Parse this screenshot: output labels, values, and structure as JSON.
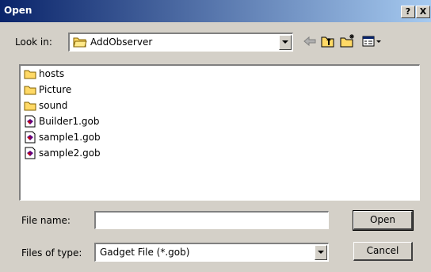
{
  "window": {
    "title": "Open",
    "help_label": "?",
    "close_label": "X"
  },
  "lookin": {
    "label": "Look in:",
    "value": "AddObserver"
  },
  "toolbar": {
    "back_icon": "back-arrow-icon",
    "up_icon": "up-folder-icon",
    "new_folder_icon": "new-folder-icon",
    "view_icon": "view-menu-icon"
  },
  "files": [
    {
      "name": "hosts",
      "type": "folder"
    },
    {
      "name": "Picture",
      "type": "folder"
    },
    {
      "name": "sound",
      "type": "folder"
    },
    {
      "name": "Builder1.gob",
      "type": "file"
    },
    {
      "name": "sample1.gob",
      "type": "file"
    },
    {
      "name": "sample2.gob",
      "type": "file"
    }
  ],
  "filename": {
    "label": "File name:",
    "value": ""
  },
  "filetype": {
    "label": "Files of type:",
    "value": "Gadget File (*.gob)"
  },
  "buttons": {
    "open": "Open",
    "cancel": "Cancel"
  },
  "colors": {
    "title_start": "#0a246a",
    "title_end": "#a6caf0",
    "face": "#d4d0c8",
    "folder": "#ffd966"
  }
}
